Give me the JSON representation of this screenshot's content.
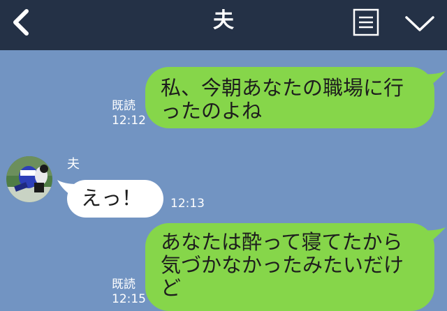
{
  "header": {
    "title": "夫",
    "back_icon": "chevron-left-icon",
    "menu_icon": "menu-list-icon",
    "collapse_icon": "chevron-down-icon"
  },
  "colors": {
    "header_bg": "#243146",
    "chat_bg": "#7294c2",
    "my_bubble": "#86d64a",
    "their_bubble": "#ffffff"
  },
  "messages": [
    {
      "sender": "me",
      "lines": [
        "私、今朝あなたの職場に行",
        "ったのよね"
      ],
      "read_label": "既読",
      "time": "12:12"
    },
    {
      "sender": "夫",
      "lines": [
        "えっ！"
      ],
      "time": "12:13"
    },
    {
      "sender": "me",
      "lines": [
        "あなたは酔って寝てたから",
        "気づかなかったみたいだけ",
        "ど"
      ],
      "read_label": "既読",
      "time": "12:15"
    }
  ]
}
